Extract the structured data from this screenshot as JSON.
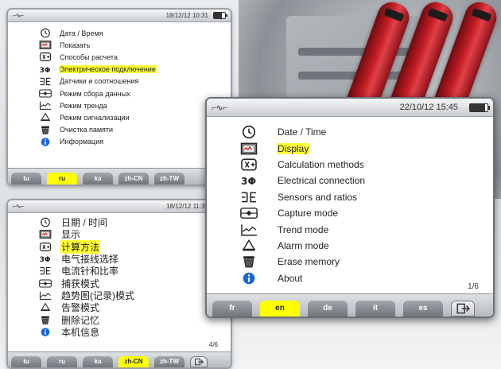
{
  "screens": {
    "ru": {
      "datetime": "18/12/12 10:31",
      "selected_index": 3,
      "items": [
        {
          "icon": "clock-icon",
          "label": "Дата / Время"
        },
        {
          "icon": "display-icon",
          "label": "Показать"
        },
        {
          "icon": "calculation-icon",
          "label": "Способы расчета"
        },
        {
          "icon": "three-phase-icon",
          "label": "Электрическое подключение"
        },
        {
          "icon": "sensor-icon",
          "label": "Датчики и соотношения"
        },
        {
          "icon": "capture-icon",
          "label": "Режим сбора данных"
        },
        {
          "icon": "trend-icon",
          "label": "Режим тренда"
        },
        {
          "icon": "alarm-bell-icon",
          "label": "Режим сигнализации"
        },
        {
          "icon": "erase-bin-icon",
          "label": "Очистка памяти"
        },
        {
          "icon": "info-icon",
          "label": "Информация"
        }
      ],
      "tabs": [
        {
          "label": "tu",
          "active": false
        },
        {
          "label": "ru",
          "active": true
        },
        {
          "label": "ka",
          "active": false
        },
        {
          "label": "zh-CN",
          "active": false
        },
        {
          "label": "zh-TW",
          "active": false
        }
      ]
    },
    "cn": {
      "datetime": "18/12/12 11:30",
      "selected_index": 2,
      "page": "4/6",
      "items": [
        {
          "icon": "clock-icon",
          "label": "日期 / 时间"
        },
        {
          "icon": "display-icon",
          "label": "显示"
        },
        {
          "icon": "calculation-icon",
          "label": "计算方法"
        },
        {
          "icon": "three-phase-icon",
          "label": "电气接线选择"
        },
        {
          "icon": "sensor-icon",
          "label": "电流针和比率"
        },
        {
          "icon": "capture-icon",
          "label": "捕获模式"
        },
        {
          "icon": "trend-icon",
          "label": "趋势图(记录)模式"
        },
        {
          "icon": "alarm-bell-icon",
          "label": "告警模式"
        },
        {
          "icon": "erase-bin-icon",
          "label": "删除记忆"
        },
        {
          "icon": "info-icon",
          "label": "本机信息"
        }
      ],
      "tabs": [
        {
          "label": "tu",
          "active": false
        },
        {
          "label": "ru",
          "active": false
        },
        {
          "label": "ka",
          "active": false
        },
        {
          "label": "zh-CN",
          "active": true
        },
        {
          "label": "zh-TW",
          "active": false
        }
      ]
    },
    "en": {
      "datetime": "22/10/12 15:45",
      "selected_index": 1,
      "page": "1/6",
      "items": [
        {
          "icon": "clock-icon",
          "label": "Date / Time"
        },
        {
          "icon": "display-icon",
          "label": "Display"
        },
        {
          "icon": "calculation-icon",
          "label": "Calculation methods"
        },
        {
          "icon": "three-phase-icon",
          "label": "Electrical connection"
        },
        {
          "icon": "sensor-icon",
          "label": "Sensors and ratios"
        },
        {
          "icon": "capture-icon",
          "label": "Capture mode"
        },
        {
          "icon": "trend-icon",
          "label": "Trend mode"
        },
        {
          "icon": "alarm-bell-icon",
          "label": "Alarm mode"
        },
        {
          "icon": "erase-bin-icon",
          "label": "Erase memory"
        },
        {
          "icon": "info-icon",
          "label": "About"
        }
      ],
      "tabs": [
        {
          "label": "fr",
          "active": false
        },
        {
          "label": "en",
          "active": true
        },
        {
          "label": "de",
          "active": false
        },
        {
          "label": "it",
          "active": false
        },
        {
          "label": "es",
          "active": false
        }
      ]
    }
  },
  "colors": {
    "highlight": "#ffff33",
    "active_tab": "#ffff00",
    "info_blue": "#1565d8"
  }
}
